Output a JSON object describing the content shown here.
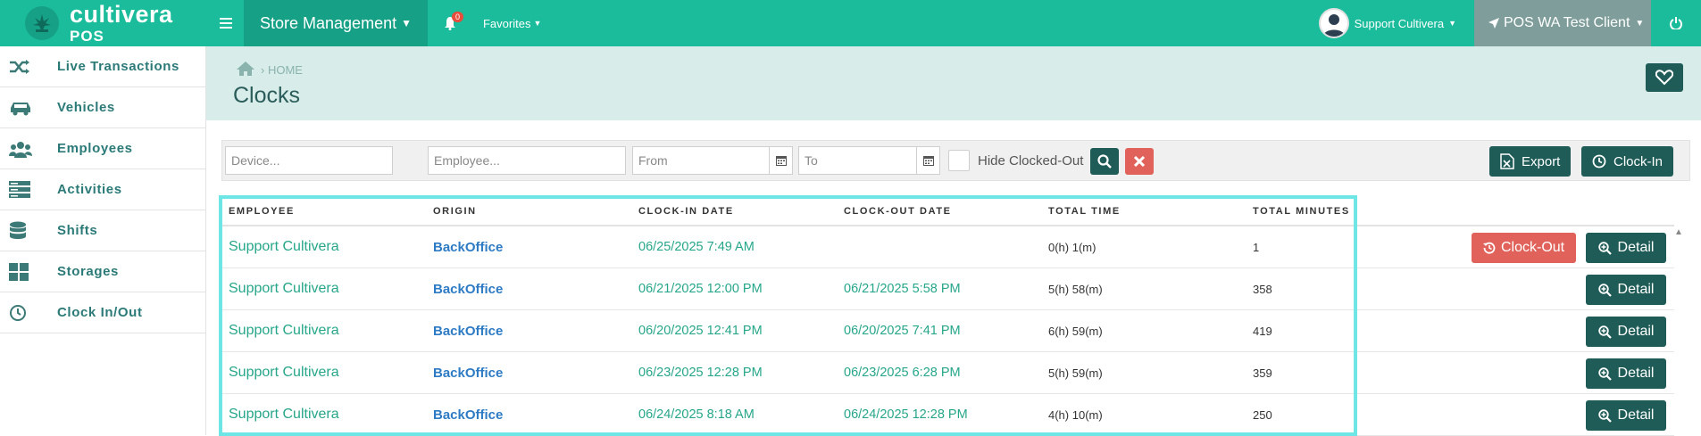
{
  "brand": {
    "name": "cultivera",
    "sub": "POS"
  },
  "topbar": {
    "store_menu": "Store Management",
    "notifications_count": "0",
    "favorites": "Favorites",
    "user_name": "Support Cultivera",
    "client": "POS WA Test Client",
    "accent_color": "#1abc9c"
  },
  "sidebar": {
    "items": [
      {
        "label": "Live Transactions",
        "icon": "shuffle-icon"
      },
      {
        "label": "Vehicles",
        "icon": "car-icon"
      },
      {
        "label": "Employees",
        "icon": "users-icon"
      },
      {
        "label": "Activities",
        "icon": "server-icon"
      },
      {
        "label": "Shifts",
        "icon": "database-icon"
      },
      {
        "label": "Storages",
        "icon": "grid-icon"
      },
      {
        "label": "Clock In/Out",
        "icon": "clock-icon"
      }
    ]
  },
  "header": {
    "breadcrumb": "HOME",
    "title": "Clocks"
  },
  "filters": {
    "device_placeholder": "Device...",
    "employee_placeholder": "Employee...",
    "from_placeholder": "From",
    "to_placeholder": "To",
    "hide_clocked_out": "Hide Clocked-Out",
    "export": "Export",
    "clock_in": "Clock-In"
  },
  "table": {
    "headers": [
      "EMPLOYEE",
      "ORIGIN",
      "CLOCK-IN DATE",
      "CLOCK-OUT DATE",
      "TOTAL TIME",
      "TOTAL MINUTES"
    ],
    "rows": [
      {
        "employee": "Support Cultivera",
        "origin": "BackOffice",
        "clock_in": "06/25/2025 7:49 AM",
        "clock_out": "",
        "total_time": "0(h) 1(m)",
        "total_minutes": "1"
      },
      {
        "employee": "Support Cultivera",
        "origin": "BackOffice",
        "clock_in": "06/21/2025 12:00 PM",
        "clock_out": "06/21/2025 5:58 PM",
        "total_time": "5(h) 58(m)",
        "total_minutes": "358"
      },
      {
        "employee": "Support Cultivera",
        "origin": "BackOffice",
        "clock_in": "06/20/2025 12:41 PM",
        "clock_out": "06/20/2025 7:41 PM",
        "total_time": "6(h) 59(m)",
        "total_minutes": "419"
      },
      {
        "employee": "Support Cultivera",
        "origin": "BackOffice",
        "clock_in": "06/23/2025 12:28 PM",
        "clock_out": "06/23/2025 6:28 PM",
        "total_time": "5(h) 59(m)",
        "total_minutes": "359"
      },
      {
        "employee": "Support Cultivera",
        "origin": "BackOffice",
        "clock_in": "06/24/2025 8:18 AM",
        "clock_out": "06/24/2025 12:28 PM",
        "total_time": "4(h) 10(m)",
        "total_minutes": "250"
      }
    ],
    "clock_out_label": "Clock-Out",
    "detail_label": "Detail"
  }
}
